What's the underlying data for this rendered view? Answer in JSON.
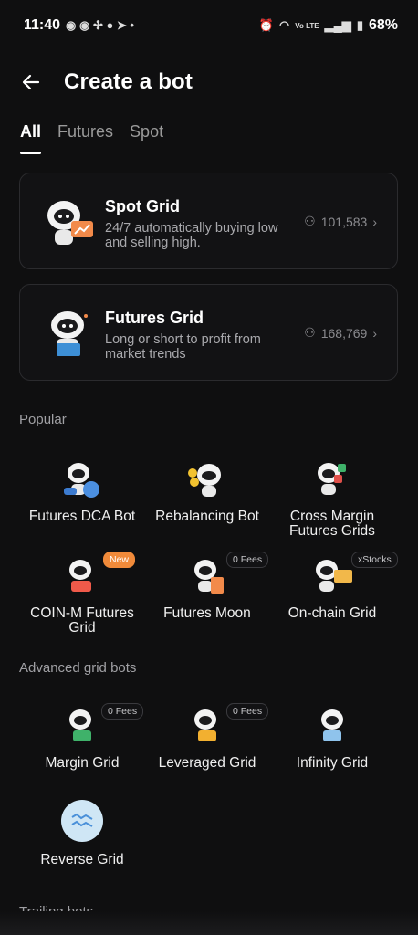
{
  "status": {
    "time": "11:40",
    "battery": "68%",
    "network": "Vo LTE"
  },
  "header": {
    "title": "Create a bot"
  },
  "tabs": [
    {
      "label": "All",
      "active": true
    },
    {
      "label": "Futures",
      "active": false
    },
    {
      "label": "Spot",
      "active": false
    }
  ],
  "cards": [
    {
      "title": "Spot Grid",
      "desc": "24/7 automatically buying low and selling high.",
      "users": "101,583"
    },
    {
      "title": "Futures Grid",
      "desc": "Long or short to profit from market trends",
      "users": "168,769"
    }
  ],
  "sections": {
    "popular": "Popular",
    "advanced": "Advanced grid bots",
    "trailing": "Trailing bots"
  },
  "popular": [
    {
      "label": "Futures DCA Bot",
      "badge": ""
    },
    {
      "label": "Rebalancing Bot",
      "badge": ""
    },
    {
      "label": "Cross Margin Futures Grids",
      "badge": ""
    },
    {
      "label": "COIN-M Futures Grid",
      "badge": "New"
    },
    {
      "label": "Futures Moon",
      "badge": "0 Fees"
    },
    {
      "label": "On-chain Grid",
      "badge": "xStocks"
    }
  ],
  "advanced": [
    {
      "label": "Margin Grid",
      "badge": "0 Fees"
    },
    {
      "label": "Leveraged Grid",
      "badge": "0 Fees"
    },
    {
      "label": "Infinity Grid",
      "badge": ""
    },
    {
      "label": "Reverse Grid",
      "badge": ""
    }
  ],
  "colors": {
    "background": "#0f0f10",
    "card_border": "#2b2b2e",
    "new_badge": "#f08a3a",
    "muted": "#8a8a8e"
  }
}
